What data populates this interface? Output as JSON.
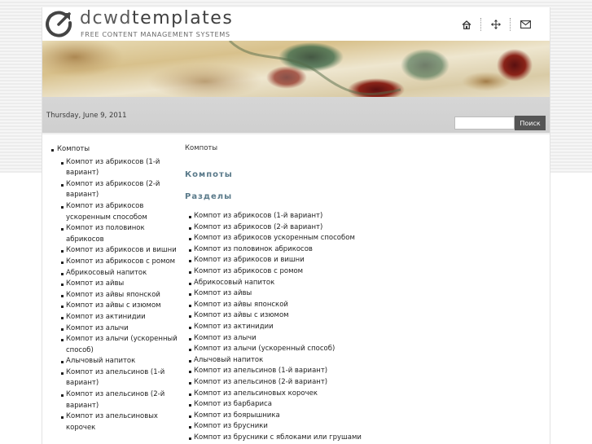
{
  "header": {
    "logo_icon": "power-arrow-logo-icon",
    "logo_prefix": "dcwd",
    "logo_name": "templates",
    "tagline": "FREE CONTENT MANAGEMENT SYSTEMS",
    "icons": [
      "home-icon",
      "sitemap-icon",
      "mail-icon"
    ]
  },
  "topbar": {
    "date": "Thursday, June 9, 2011",
    "search_placeholder": "",
    "search_button": "Поиск"
  },
  "sidebar": {
    "root_label": "Компоты",
    "items": [
      "Компот из абрикосов (1-й вариант)",
      "Компот из абрикосов (2-й вариант)",
      "Компот из абрикосов ускоренным способом",
      "Компот из половинок абрикосов",
      "Компот из абрикосов и вишни",
      "Компот из абрикосов с ромом",
      "Абрикосовый напиток",
      "Компот из айвы",
      "Компот из айвы японской",
      "Компот из айвы с изюмом",
      "Компот из актинидии",
      "Компот из алычи",
      "Компот из алычи (ускоренный способ)",
      "Алычовый напиток",
      "Компот из апельсинов (1-й вариант)",
      "Компот из апельсинов (2-й вариант)",
      "Компот из апельсиновых корочек"
    ]
  },
  "main": {
    "breadcrumb": "Компоты",
    "category_title": "Компоты",
    "sections_title": "Разделы",
    "items": [
      "Компот из абрикосов (1-й вариант)",
      "Компот из абрикосов (2-й вариант)",
      "Компот из абрикосов ускоренным способом",
      "Компот из половинок абрикосов",
      "Компот из абрикосов и вишни",
      "Компот из абрикосов с ромом",
      "Абрикосовый напиток",
      "Компот из айвы",
      "Компот из айвы японской",
      "Компот из айвы с изюмом",
      "Компот из актинидии",
      "Компот из алычи",
      "Компот из алычи (ускоренный способ)",
      "Алычовый напиток",
      "Компот из апельсинов (1-й вариант)",
      "Компот из апельсинов (2-й вариант)",
      "Компот из апельсиновых корочек",
      "Компот из барбариса",
      "Компот из боярышника",
      "Компот из брусники",
      "Компот из брусники с яблоками или грушами"
    ]
  },
  "colors": {
    "heading": "#5a7a8a",
    "search_button_bg": "#555555",
    "date_bar": "#d3d3d3"
  }
}
